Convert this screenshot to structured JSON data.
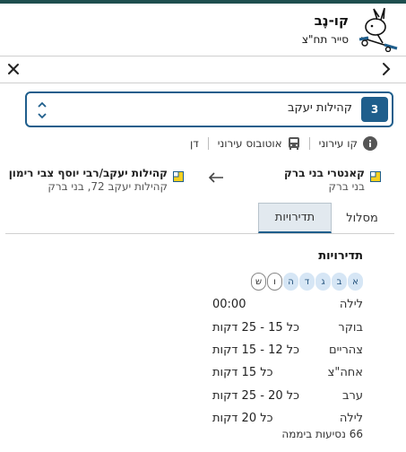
{
  "brand": {
    "title": "קו-נֶב",
    "subtitle": "סייר תח\"צ",
    "logo_icon": "rabbit-scooter-logo"
  },
  "nav": {
    "close_icon": "close-icon",
    "forward_icon": "chevron-right-icon"
  },
  "route": {
    "number": "3",
    "name": "קהילות יעקב",
    "color": "#1f5e8c",
    "chevron_icon": "chevron-up-down-icon"
  },
  "meta": {
    "line_type": "קו עירוני",
    "vehicle": "אוטובוס עירוני",
    "operator": "דן"
  },
  "trip": {
    "origin": {
      "name": "קאנטרי בני ברק",
      "address": "בני ברק"
    },
    "destination": {
      "name": "קהילות יעקב/רבי יוסף צבי רימון",
      "address": "קהילות יעקב 72, בני ברק"
    }
  },
  "tabs": [
    {
      "label": "מסלול",
      "active": false
    },
    {
      "label": "תדירויות",
      "active": true
    }
  ],
  "frequencies": {
    "title": "תדירויות",
    "days": [
      {
        "label": "א",
        "active": true
      },
      {
        "label": "ב",
        "active": true
      },
      {
        "label": "ג",
        "active": true
      },
      {
        "label": "ד",
        "active": true
      },
      {
        "label": "ה",
        "active": true
      },
      {
        "label": "ו",
        "active": false
      },
      {
        "label": "ש",
        "active": false
      }
    ],
    "rows": [
      {
        "period": "לילה",
        "value": "00:00"
      },
      {
        "period": "בוקר",
        "value": "כל 15 - 25 דקות"
      },
      {
        "period": "צהריים",
        "value": "כל 12 - 15 דקות"
      },
      {
        "period": "אחה\"צ",
        "value": "כל 15 דקות"
      },
      {
        "period": "ערב",
        "value": "כל 20 - 25 דקות"
      },
      {
        "period": "לילה",
        "value": "כל 20 דקות"
      }
    ],
    "total": "66 נסיעות ביממה"
  }
}
